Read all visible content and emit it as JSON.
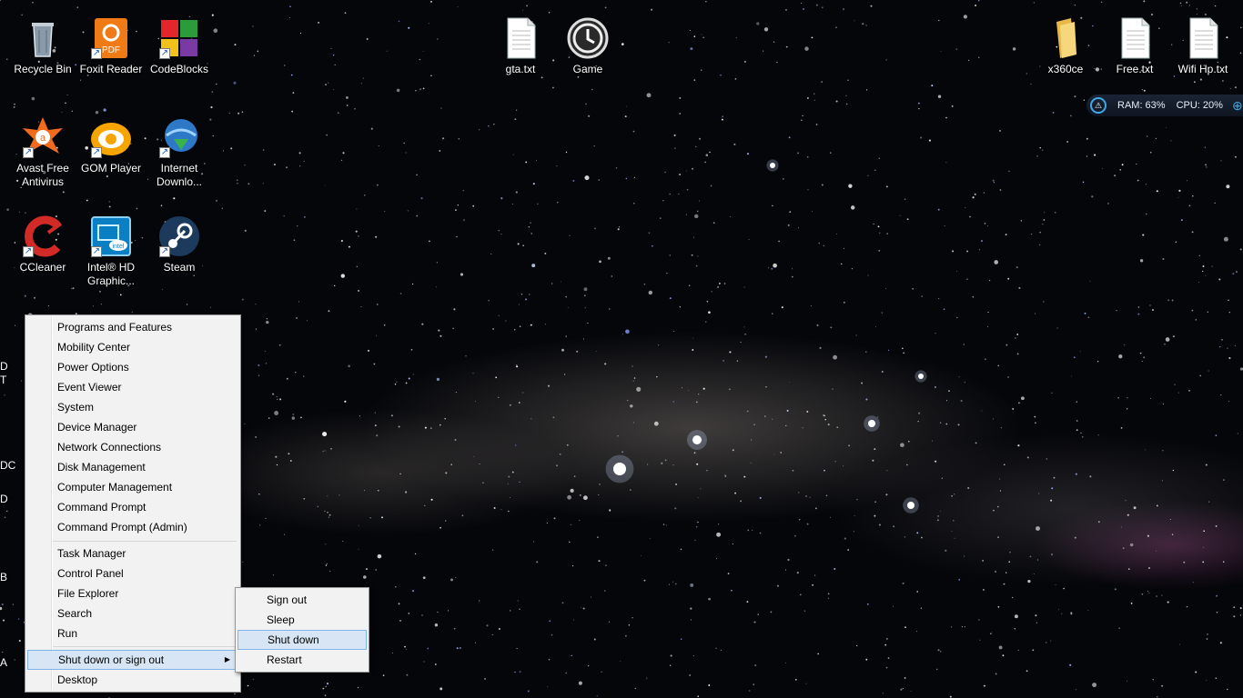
{
  "desktop": {
    "icons": [
      {
        "name": "recycle-bin",
        "label": "Recycle Bin",
        "glyph": "recycle-bin-icon"
      },
      {
        "name": "foxit-reader",
        "label": "Foxit Reader",
        "glyph": "foxit-pdf-icon"
      },
      {
        "name": "codeblocks",
        "label": "CodeBlocks",
        "glyph": "codeblocks-icon"
      },
      {
        "name": "avast",
        "label": "Avast Free\nAntivirus",
        "glyph": "avast-icon"
      },
      {
        "name": "gom-player",
        "label": "GOM Player",
        "glyph": "gom-player-icon"
      },
      {
        "name": "internet-download",
        "label": "Internet\nDownlo...",
        "glyph": "idm-icon"
      },
      {
        "name": "ccleaner",
        "label": "CCleaner",
        "glyph": "ccleaner-icon"
      },
      {
        "name": "intel-hd",
        "label": "Intel® HD\nGraphic...",
        "glyph": "intel-graphics-icon"
      },
      {
        "name": "steam",
        "label": "Steam",
        "glyph": "steam-icon"
      },
      {
        "name": "gta-txt",
        "label": "gta.txt",
        "glyph": "text-file-icon"
      },
      {
        "name": "game",
        "label": "Game",
        "glyph": "clock-icon"
      },
      {
        "name": "x360ce",
        "label": "x360ce",
        "glyph": "folder-icon"
      },
      {
        "name": "free-txt",
        "label": "Free.txt",
        "glyph": "text-file-icon"
      },
      {
        "name": "wifi-hp-txt",
        "label": "Wifi Hp.txt",
        "glyph": "text-file-icon"
      }
    ],
    "edge_fragments": [
      "D",
      "T",
      "DC",
      "D",
      "B",
      "A"
    ]
  },
  "widget": {
    "ram": "RAM: 63%",
    "cpu": "CPU: 20%"
  },
  "winx_menu": {
    "group1": [
      "Programs and Features",
      "Mobility Center",
      "Power Options",
      "Event Viewer",
      "System",
      "Device Manager",
      "Network Connections",
      "Disk Management",
      "Computer Management",
      "Command Prompt",
      "Command Prompt (Admin)"
    ],
    "group2": [
      "Task Manager",
      "Control Panel",
      "File Explorer",
      "Search",
      "Run"
    ],
    "shutdown_label": "Shut down or sign out",
    "desktop_label": "Desktop"
  },
  "shutdown_submenu": {
    "items": [
      "Sign out",
      "Sleep",
      "Shut down",
      "Restart"
    ],
    "highlighted": "Shut down"
  },
  "colors": {
    "menu_bg": "#f2f2f2",
    "highlight": "#d7e5f4",
    "highlight_border": "#7eb4ea",
    "widget_accent": "#3fa8e8"
  }
}
